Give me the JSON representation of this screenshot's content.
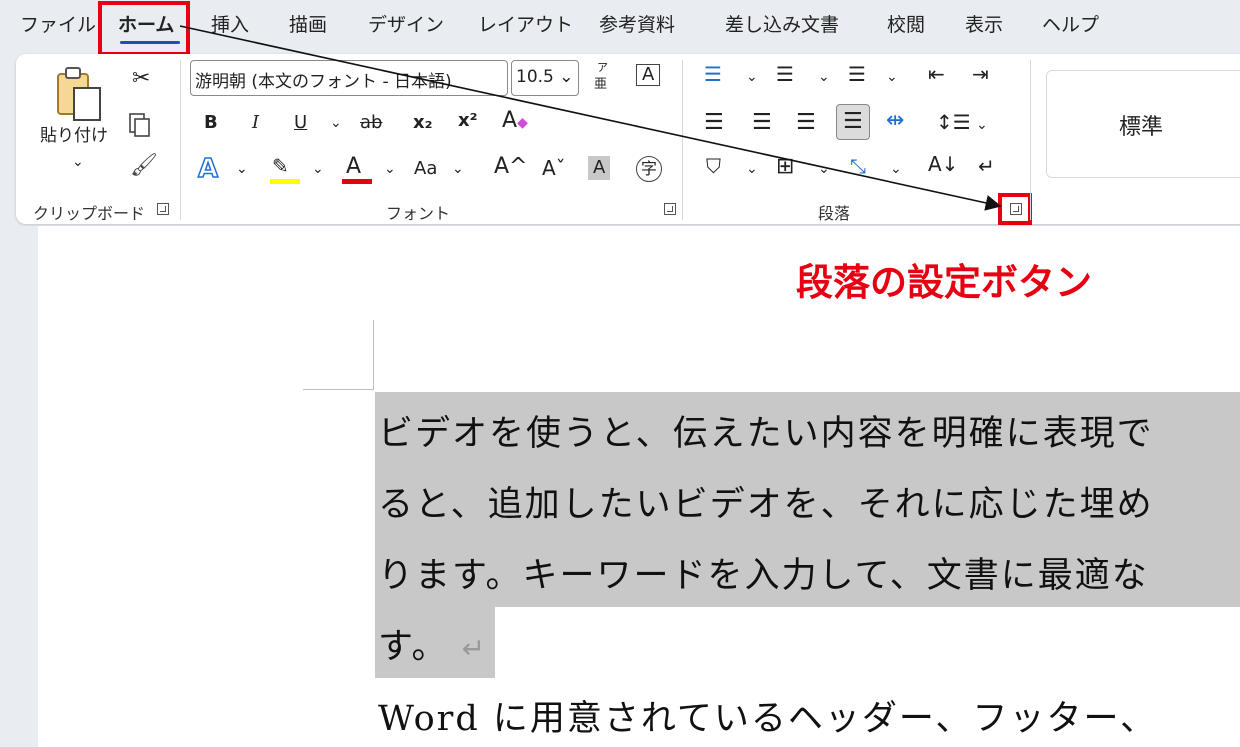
{
  "menu": {
    "tabs": [
      "ファイル",
      "ホーム",
      "挿入",
      "描画",
      "デザイン",
      "レイアウト",
      "参考資料",
      "差し込み文書",
      "校閲",
      "表示",
      "ヘルプ"
    ]
  },
  "ribbon": {
    "clipboard": {
      "paste_label": "貼り付け",
      "group_label": "クリップボード"
    },
    "font": {
      "font_name": "游明朝 (本文のフォント - 日本語)",
      "font_size": "10.5",
      "phonetic_top": "ア",
      "phonetic_bottom": "亜",
      "enclosed_char": "A",
      "bold": "B",
      "italic": "I",
      "underline": "U",
      "strike": "ab",
      "subscript": "x₂",
      "superscript": "x²",
      "text_effect": "A",
      "font_color": "A",
      "change_case": "Aa",
      "grow": "A^",
      "shrink": "Aˇ",
      "char_shading": "A",
      "enclose": "字",
      "group_label": "フォント"
    },
    "paragraph": {
      "group_label": "段落"
    },
    "styles": {
      "normal": "標準"
    }
  },
  "document": {
    "lines": [
      "ビデオを使うと、伝えたい内容を明確に表現で",
      "ると、追加したいビデオを、それに応じた埋め",
      "ります。キーワードを入力して、文書に最適な",
      "す。"
    ],
    "paragraph_mark": "↵",
    "next_line": "Word に用意されているヘッダー、フッター、"
  },
  "annotation": {
    "callout": "段落の設定ボタン"
  },
  "colors": {
    "highlight": "#e60012",
    "accent": "#1f4fb5",
    "selection": "#c8c8c8"
  }
}
